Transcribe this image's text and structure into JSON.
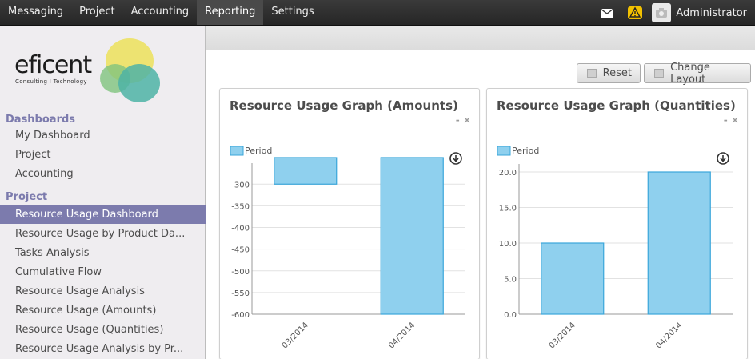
{
  "topbar": {
    "menu": [
      {
        "label": "Messaging"
      },
      {
        "label": "Project"
      },
      {
        "label": "Accounting"
      },
      {
        "label": "Reporting",
        "active": true
      },
      {
        "label": "Settings"
      }
    ],
    "user": "Administrator",
    "icons": [
      "mail-icon",
      "alert-icon",
      "avatar-camera-icon"
    ]
  },
  "logo": {
    "name": "eficent",
    "tagline": "Consulting I Technology"
  },
  "sidebar": {
    "dashboards_title": "Dashboards",
    "dashboards_items": [
      {
        "label": "My Dashboard"
      },
      {
        "label": "Project"
      },
      {
        "label": "Accounting"
      }
    ],
    "project_title": "Project",
    "project_items": [
      {
        "label": "Resource Usage Dashboard",
        "active": true
      },
      {
        "label": "Resource Usage by Product Da..."
      },
      {
        "label": "Tasks Analysis"
      },
      {
        "label": "Cumulative Flow"
      },
      {
        "label": "Resource Usage Analysis"
      },
      {
        "label": "Resource Usage (Amounts)"
      },
      {
        "label": "Resource Usage (Quantities)"
      },
      {
        "label": "Resource Usage Analysis by Pr..."
      }
    ]
  },
  "toolbar": {
    "reset_label": "Reset",
    "change_layout_label": "Change Layout"
  },
  "panels": [
    {
      "title": "Resource Usage Graph (Amounts)",
      "tools": "- ×"
    },
    {
      "title": "Resource Usage Graph (Quantities)",
      "tools": "- ×"
    }
  ],
  "colors": {
    "bar_fill": "#8fd0ee",
    "bar_stroke": "#3aa6da",
    "accent": "#7c7bad"
  },
  "chart_data": [
    {
      "type": "bar",
      "legend": [
        "Period"
      ],
      "categories": [
        "03/2014",
        "04/2014"
      ],
      "series": [
        {
          "name": "Period",
          "values": [
            -300,
            -600
          ]
        }
      ],
      "ylim": [
        -600,
        -270
      ],
      "yticks": [
        -300,
        -350,
        -400,
        -450,
        -500,
        -550,
        -600
      ],
      "ytick_labels": [
        "-300",
        "-350",
        "-400",
        "-450",
        "-500",
        "-550",
        "-600"
      ],
      "grid": true
    },
    {
      "type": "bar",
      "legend": [
        "Period"
      ],
      "categories": [
        "03/2014",
        "04/2014"
      ],
      "series": [
        {
          "name": "Period",
          "values": [
            10.0,
            20.0
          ]
        }
      ],
      "ylim": [
        0,
        20
      ],
      "yticks": [
        0,
        5,
        10,
        15,
        20
      ],
      "ytick_labels": [
        "0.0",
        "5.0",
        "10.0",
        "15.0",
        "20.0"
      ],
      "grid": true
    }
  ]
}
